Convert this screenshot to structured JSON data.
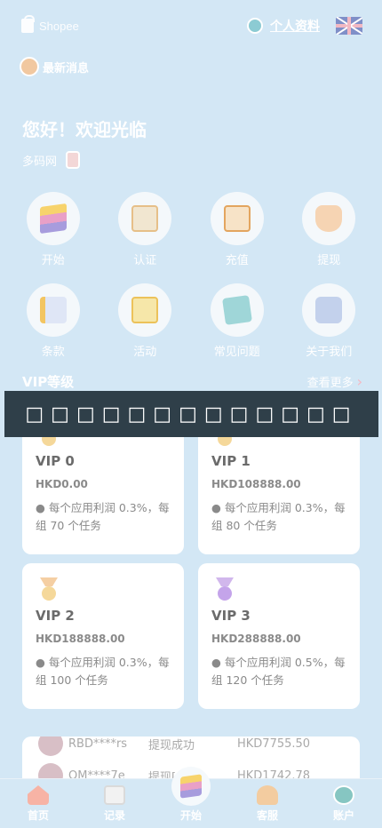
{
  "header": {
    "brand": "Shopee",
    "profile_label": "个人资料",
    "language_icon": "uk-flag-icon"
  },
  "notice": {
    "text": "最新消息"
  },
  "greeting": "您好！欢迎光临",
  "user": {
    "name": "多码网"
  },
  "menu": [
    {
      "label": "开始",
      "icon": "layers-icon"
    },
    {
      "label": "认证",
      "icon": "certificate-icon"
    },
    {
      "label": "充值",
      "icon": "safe-icon"
    },
    {
      "label": "提现",
      "icon": "withdraw-icon"
    },
    {
      "label": "条款",
      "icon": "document-icon"
    },
    {
      "label": "活动",
      "icon": "envelope-icon"
    },
    {
      "label": "常见问题",
      "icon": "question-icon"
    },
    {
      "label": "关于我们",
      "icon": "info-icon"
    }
  ],
  "vip": {
    "title": "VIP等级",
    "more": "查看更多",
    "cards": [
      {
        "name": "VIP 0",
        "price": "HKD0.00",
        "desc": "● 每个应用利润 0.3%，每组 70 个任务"
      },
      {
        "name": "VIP 1",
        "price": "HKD108888.00",
        "desc": "● 每个应用利润 0.3%，每组 80 个任务"
      },
      {
        "name": "VIP 2",
        "price": "HKD188888.00",
        "desc": "● 每个应用利润 0.3%，每组 100 个任务"
      },
      {
        "name": "VIP 3",
        "price": "HKD288888.00",
        "desc": "● 每个应用利润 0.5%，每组 120 个任务"
      }
    ]
  },
  "overlay_text": "□□□□□□□□□□□□□",
  "ticker": [
    {
      "user": "RBD****rs",
      "status": "提现成功",
      "amount": "HKD7755.50"
    },
    {
      "user": "QM****7e",
      "status": "提现[",
      "amount": "HKD1742.78"
    }
  ],
  "tabs": [
    {
      "label": "首页"
    },
    {
      "label": "记录"
    },
    {
      "label": "开始"
    },
    {
      "label": "客服"
    },
    {
      "label": "账户"
    }
  ]
}
